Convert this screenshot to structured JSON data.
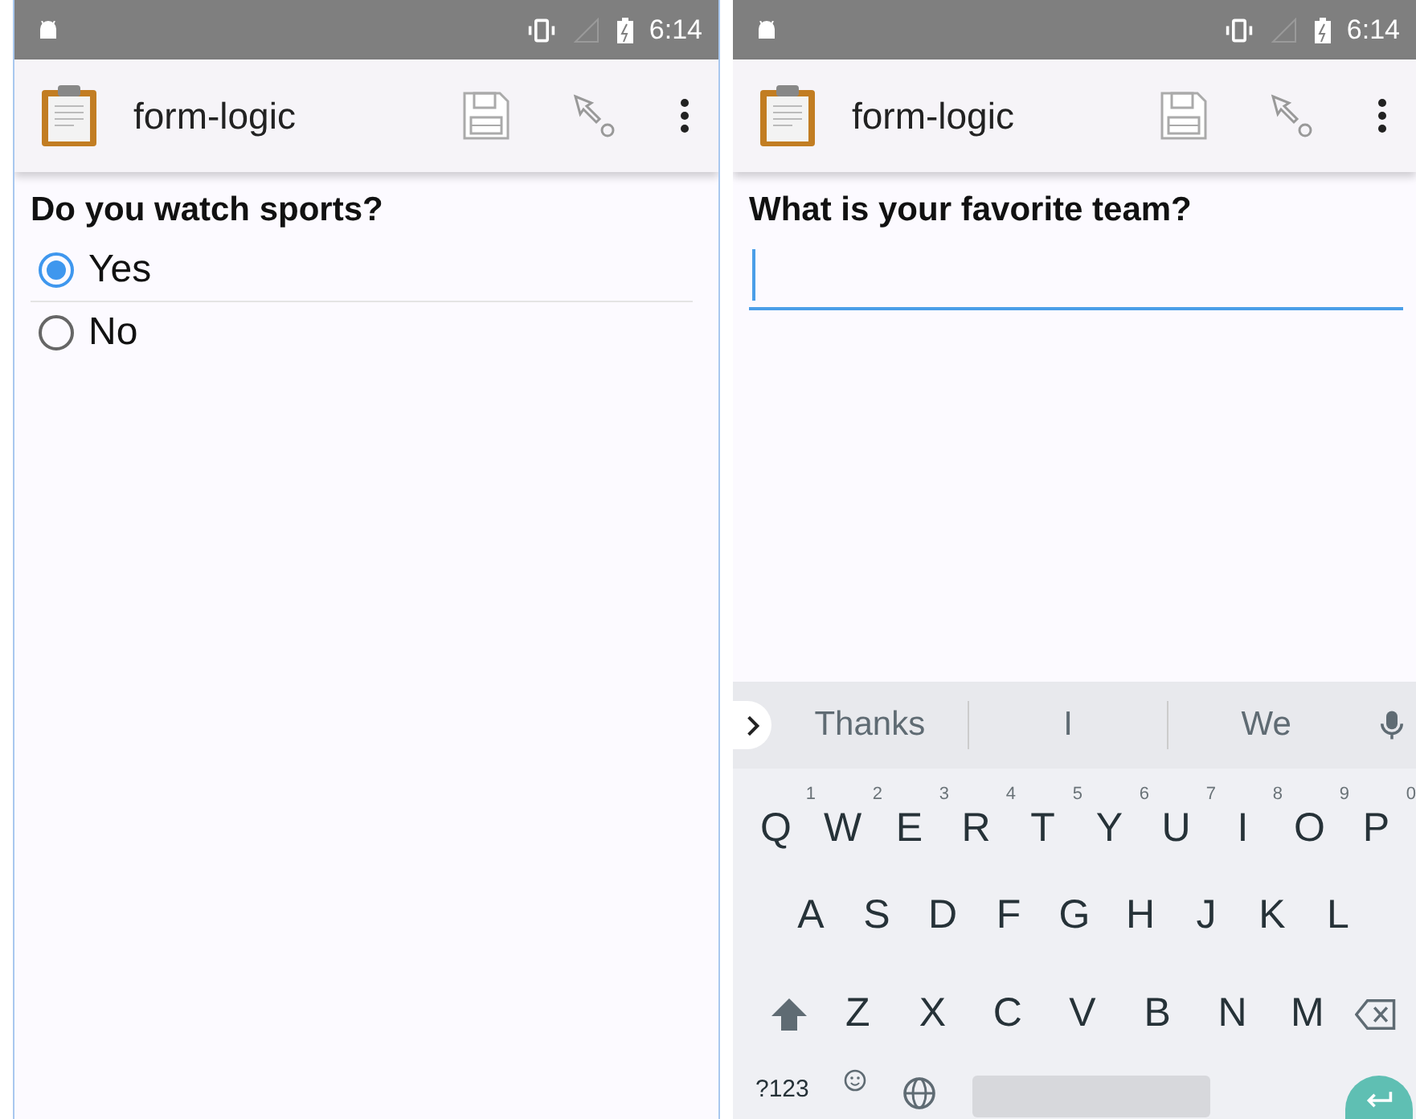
{
  "screens": [
    {
      "status_bar": {
        "time": "6:14"
      },
      "toolbar": {
        "title": "form-logic"
      },
      "question": {
        "kind": "select_one",
        "label": "Do you watch sports?",
        "options": [
          {
            "label": "Yes",
            "selected": true
          },
          {
            "label": "No",
            "selected": false
          }
        ]
      }
    },
    {
      "status_bar": {
        "time": "6:14"
      },
      "toolbar": {
        "title": "form-logic"
      },
      "question": {
        "kind": "text",
        "label": "What is your favorite team?",
        "focused": true
      },
      "keyboard": {
        "suggestions": [
          "Thanks",
          "I",
          "We"
        ],
        "top_row": [
          {
            "key": "Q",
            "hint": "1"
          },
          {
            "key": "W",
            "hint": "2"
          },
          {
            "key": "E",
            "hint": "3"
          },
          {
            "key": "R",
            "hint": "4"
          },
          {
            "key": "T",
            "hint": "5"
          },
          {
            "key": "Y",
            "hint": "6"
          },
          {
            "key": "U",
            "hint": "7"
          },
          {
            "key": "I",
            "hint": "8"
          },
          {
            "key": "O",
            "hint": "9"
          },
          {
            "key": "P",
            "hint": "0"
          }
        ],
        "home_row": [
          "A",
          "S",
          "D",
          "F",
          "G",
          "H",
          "J",
          "K",
          "L"
        ],
        "bottom_row": [
          "Z",
          "X",
          "C",
          "V",
          "B",
          "N",
          "M"
        ],
        "symbols_key": "?123"
      }
    }
  ]
}
